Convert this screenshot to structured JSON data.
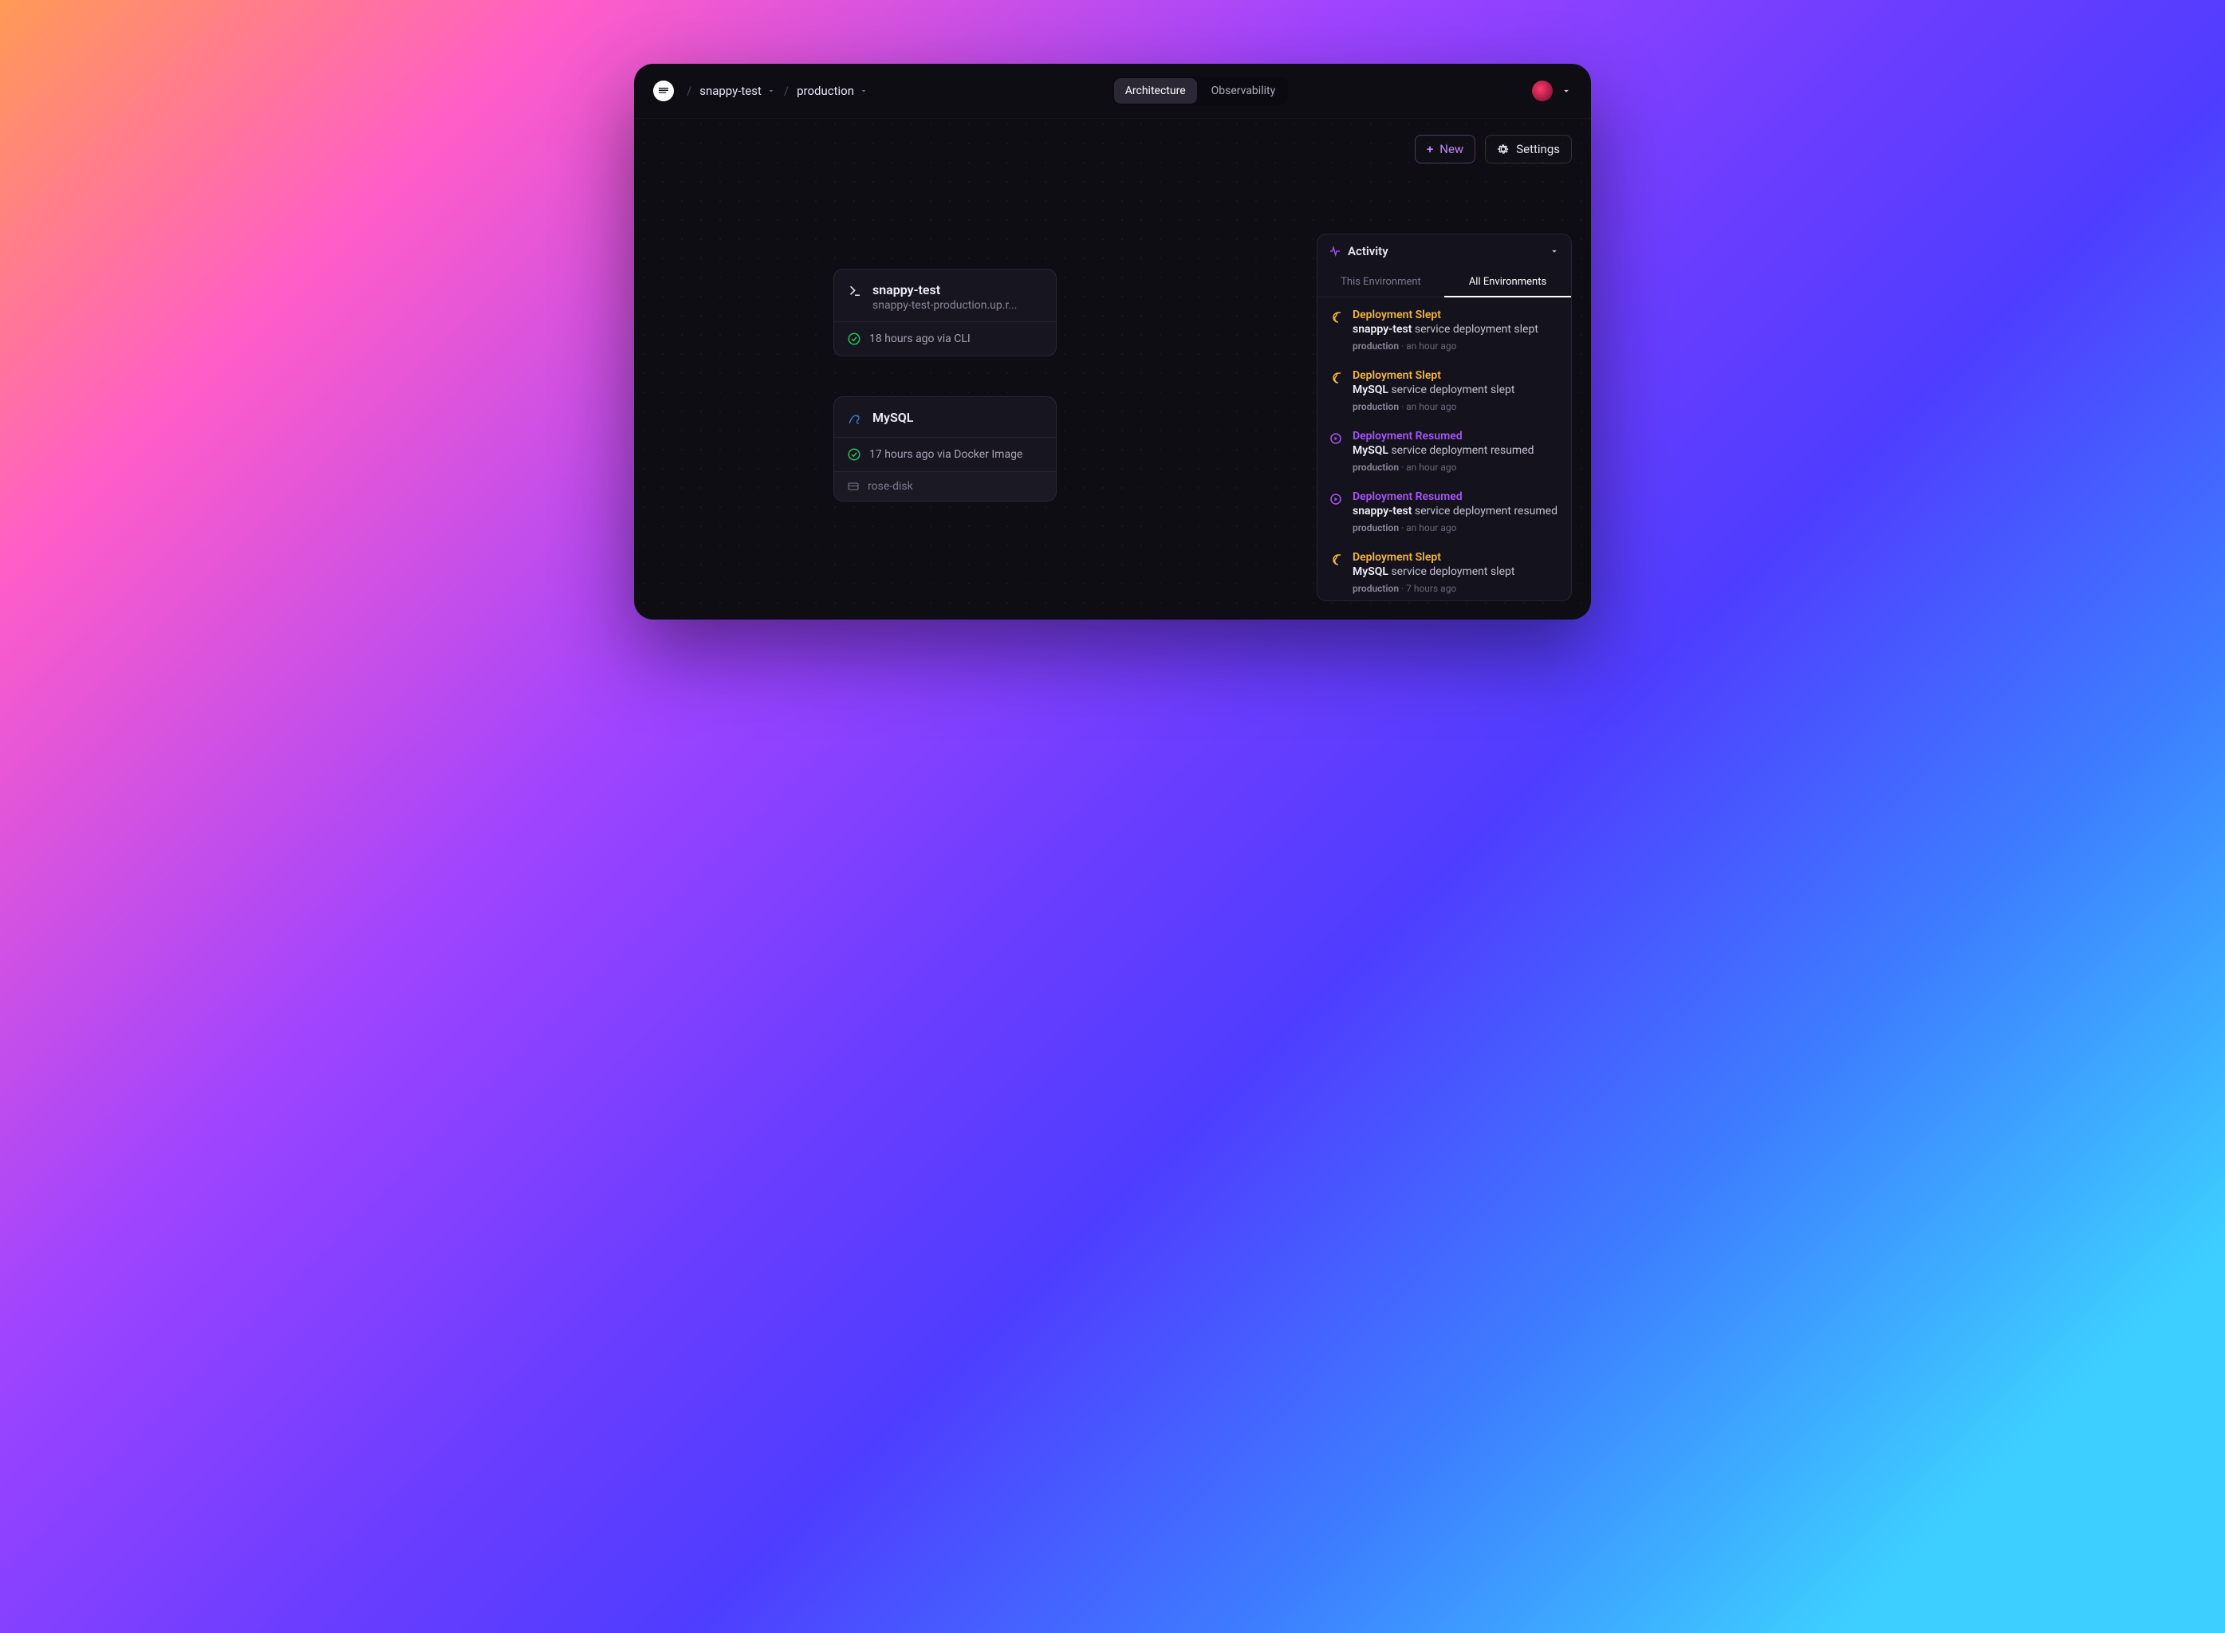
{
  "breadcrumbs": {
    "project": "snappy-test",
    "env": "production"
  },
  "header_tabs": {
    "arch": "Architecture",
    "obs": "Observability"
  },
  "toolbar": {
    "new_label": "New",
    "settings_label": "Settings"
  },
  "cards": {
    "snappy": {
      "title": "snappy-test",
      "subtitle": "snappy-test-production.up.r...",
      "status": "18 hours ago via CLI"
    },
    "mysql": {
      "title": "MySQL",
      "status": "17 hours ago via Docker Image",
      "volume": "rose-disk"
    }
  },
  "activity": {
    "title": "Activity",
    "tab_this": "This Environment",
    "tab_all": "All Environments",
    "items": [
      {
        "kind": "slept",
        "title": "Deployment Slept",
        "subject": "snappy-test",
        "rest": " service deployment slept",
        "env": "production",
        "time": "an hour ago"
      },
      {
        "kind": "slept",
        "title": "Deployment Slept",
        "subject": "MySQL",
        "rest": " service deployment slept",
        "env": "production",
        "time": "an hour ago"
      },
      {
        "kind": "resumed",
        "title": "Deployment Resumed",
        "subject": "MySQL",
        "rest": " service deployment resumed",
        "env": "production",
        "time": "an hour ago"
      },
      {
        "kind": "resumed",
        "title": "Deployment Resumed",
        "subject": "snappy-test",
        "rest": " service deployment resumed",
        "env": "production",
        "time": "an hour ago"
      },
      {
        "kind": "slept",
        "title": "Deployment Slept",
        "subject": "MySQL",
        "rest": " service deployment slept",
        "env": "production",
        "time": "7 hours ago"
      }
    ]
  }
}
